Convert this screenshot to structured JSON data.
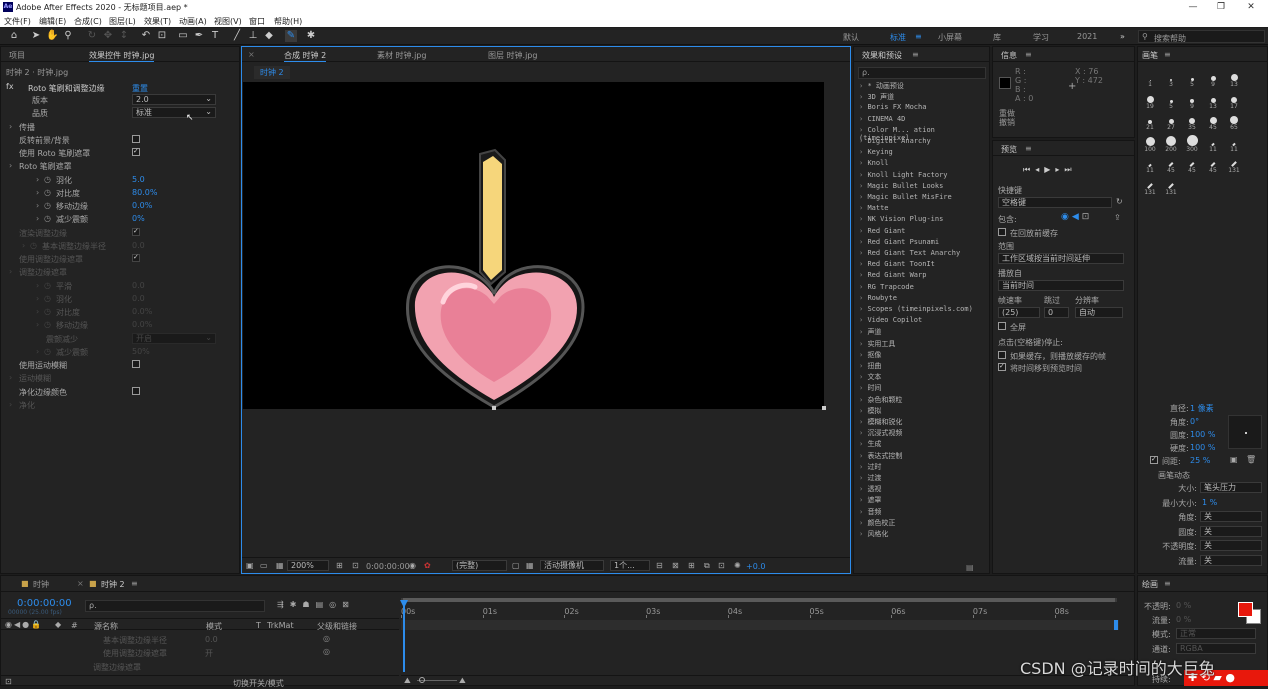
{
  "app": {
    "title": "Adobe After Effects 2020 - 无标题项目.aep *",
    "logo": "Ae"
  },
  "window_controls": [
    "—",
    "❐",
    "✕"
  ],
  "menu": [
    "文件(F)",
    "编辑(E)",
    "合成(C)",
    "图层(L)",
    "效果(T)",
    "动画(A)",
    "视图(V)",
    "窗口",
    "帮助(H)"
  ],
  "workspaces": {
    "items": [
      "默认",
      "标准",
      "小屏幕",
      "库",
      "学习",
      "2021"
    ],
    "active": "标准",
    "more": "»",
    "search_placeholder": "搜索帮助"
  },
  "left_panel": {
    "tab_project": "项目",
    "tab_effects": "效果控件 时钟.jpg",
    "crumb": "时钟 2 · 时钟.jpg",
    "effect_name": "Roto 笔刷和调整边缘",
    "reset": "重置",
    "rows": [
      {
        "label": "版本",
        "value": "2.0",
        "kind": "dropdown"
      },
      {
        "label": "品质",
        "value": "标准",
        "kind": "dropdown"
      },
      {
        "label": "传播",
        "kind": "group"
      },
      {
        "label": "反转前景/背景",
        "kind": "checkbox",
        "checked": false
      },
      {
        "label": "使用 Roto 笔刷遮罩",
        "kind": "checkbox",
        "checked": true
      },
      {
        "label": "Roto 笔刷遮罩",
        "kind": "group"
      },
      {
        "label": "羽化",
        "value": "5.0",
        "kind": "param"
      },
      {
        "label": "对比度",
        "value": "80.0%",
        "kind": "param"
      },
      {
        "label": "移动边缘",
        "value": "0.0%",
        "kind": "param"
      },
      {
        "label": "减少震颤",
        "value": "0%",
        "kind": "param"
      },
      {
        "label": "渲染调整边缘",
        "kind": "checkbox-dim",
        "checked": true
      },
      {
        "label": "基本调整边缘半径",
        "value": "0.0",
        "kind": "param-dim"
      },
      {
        "label": "使用调整边缘遮罩",
        "kind": "checkbox-dim",
        "checked": true
      },
      {
        "label": "调整边缘遮罩",
        "kind": "group-dim"
      },
      {
        "label": "平滑",
        "value": "0.0",
        "kind": "param-dim"
      },
      {
        "label": "羽化",
        "value": "0.0",
        "kind": "param-dim"
      },
      {
        "label": "对比度",
        "value": "0.0%",
        "kind": "param-dim"
      },
      {
        "label": "移动边缘",
        "value": "0.0%",
        "kind": "param-dim"
      },
      {
        "label": "震颤减少",
        "value": "开启",
        "kind": "dropdown-dim"
      },
      {
        "label": "减少震颤",
        "value": "50%",
        "kind": "param-dim"
      },
      {
        "label": "使用运动模糊",
        "kind": "checkbox",
        "checked": false
      },
      {
        "label": "运动模糊",
        "kind": "group-dim"
      },
      {
        "label": "净化边缘颜色",
        "kind": "checkbox",
        "checked": false
      },
      {
        "label": "净化",
        "kind": "group-dim"
      }
    ]
  },
  "comp_panel": {
    "tabs": [
      "合成 时钟 2",
      "素材 时钟.jpg",
      "图层 时钟.jpg"
    ],
    "active_tab": "合成 时钟 2",
    "flow_tab": "时钟 2",
    "footer": {
      "zoom": "200%",
      "timecode": "0:00:00:00",
      "resolution": "(完整)",
      "camera": "活动摄像机",
      "views": "1个...",
      "exposure": "+0.0"
    }
  },
  "effects_panel": {
    "title": "效果和预设",
    "search_placeholder": "ρ.",
    "items": [
      "* 动画预设",
      "3D 声道",
      "Boris FX Mocha",
      "CINEMA 4D",
      "Color M... ation (timeinpixel",
      "Digital Anarchy",
      "Keying",
      "Knoll",
      "Knoll Light Factory",
      "Magic Bullet Looks",
      "Magic Bullet MisFire",
      "Matte",
      "NK Vision Plug-ins",
      "Red Giant",
      "Red Giant Psunami",
      "Red Giant Text Anarchy",
      "Red Giant ToonIt",
      "Red Giant Warp",
      "RG Trapcode",
      "Rowbyte",
      "Scopes (timeinpixels.com)",
      "Video Copilot",
      "声道",
      "实用工具",
      "抠像",
      "扭曲",
      "文本",
      "时间",
      "杂色和颗粒",
      "模拟",
      "模糊和锐化",
      "沉浸式视频",
      "生成",
      "表达式控制",
      "过时",
      "过渡",
      "透视",
      "遮罩",
      "音频",
      "颜色校正",
      "风格化"
    ]
  },
  "info_panel": {
    "title": "信息",
    "r": "R :",
    "g": "G :",
    "b": "B :",
    "a": "A : 0",
    "x": "X : 76",
    "y": "Y : 472",
    "line1": "重做",
    "line2": "撤销"
  },
  "preview_panel": {
    "title": "预览",
    "shortcut_label": "快捷键",
    "shortcut_value": "空格键",
    "include_label": "包含:",
    "cache_label": "在回放前缓存",
    "range_label": "范围",
    "range_value": "工作区域按当前时间延伸",
    "playfrom_label": "播放自",
    "playfrom_value": "当前时间",
    "framerate_label": "帧速率",
    "skip_label": "跳过",
    "resolution_label": "分辨率",
    "framerate_value": "(25)",
    "skip_value": "0",
    "resolution_value": "自动",
    "fullscreen_label": "全屏",
    "stop_note": "点击(空格键)停止:",
    "opt1": "如果缓存，则播放缓存的帧",
    "opt2": "将时间移到预览时间"
  },
  "brushes_panel": {
    "title": "画笔",
    "sizes": [
      "1",
      "3",
      "5",
      "9",
      "13",
      "19",
      "5",
      "9",
      "13",
      "17",
      "21",
      "27",
      "35",
      "45",
      "65",
      "100",
      "200",
      "300",
      "11",
      "11",
      "11",
      "45",
      "45",
      "45",
      "131",
      "131",
      "131"
    ],
    "diameter_label": "直径:",
    "diameter_value": "1 像素",
    "angle_label": "角度:",
    "angle_value": "0°",
    "roundness_label": "圆度:",
    "roundness_value": "100 %",
    "hardness_label": "硬度:",
    "hardness_value": "100 %",
    "spacing_label": "间距:",
    "spacing_value": "25 %",
    "dynamics_title": "画笔动态",
    "dyn": [
      {
        "label": "大小:",
        "value": "笔头压力"
      },
      {
        "label": "最小大小:",
        "value": "1 %"
      },
      {
        "label": "角度:",
        "value": "关"
      },
      {
        "label": "圆度:",
        "value": "关"
      },
      {
        "label": "不透明度:",
        "value": "关"
      },
      {
        "label": "流量:",
        "value": "关"
      }
    ]
  },
  "paint_panel": {
    "title": "绘画",
    "opacity_label": "不透明:",
    "opacity_value": "0 %",
    "flow_label": "流量:",
    "flow_value": "0 %",
    "mode_label": "模式:",
    "mode_value": "正常",
    "channel_label": "通道:",
    "channel_value": "RGBA",
    "duration_label": "持续:",
    "fg_color": "#e8180c"
  },
  "timeline": {
    "tabs": [
      "时钟",
      "时钟 2"
    ],
    "active_tab": "时钟 2",
    "timecode": "0:00:00:00",
    "timecode_sub": "00000 (25.00 fps)",
    "search_placeholder": "ρ.",
    "columns": [
      "源名称",
      "模式",
      "T",
      "TrkMat",
      "父级和链接"
    ],
    "layers": [
      {
        "name": "基本调整边缘半径",
        "value": "0.0"
      },
      {
        "name": "使用调整边缘遮罩",
        "value": "开"
      },
      {
        "name": "调整边缘遮罩",
        "value": ""
      }
    ],
    "ticks": [
      "00s",
      "01s",
      "02s",
      "03s",
      "04s",
      "05s",
      "06s",
      "07s",
      "08s"
    ],
    "footer": "切换开关/模式"
  },
  "watermark": "CSDN @记录时间的大巨兔"
}
